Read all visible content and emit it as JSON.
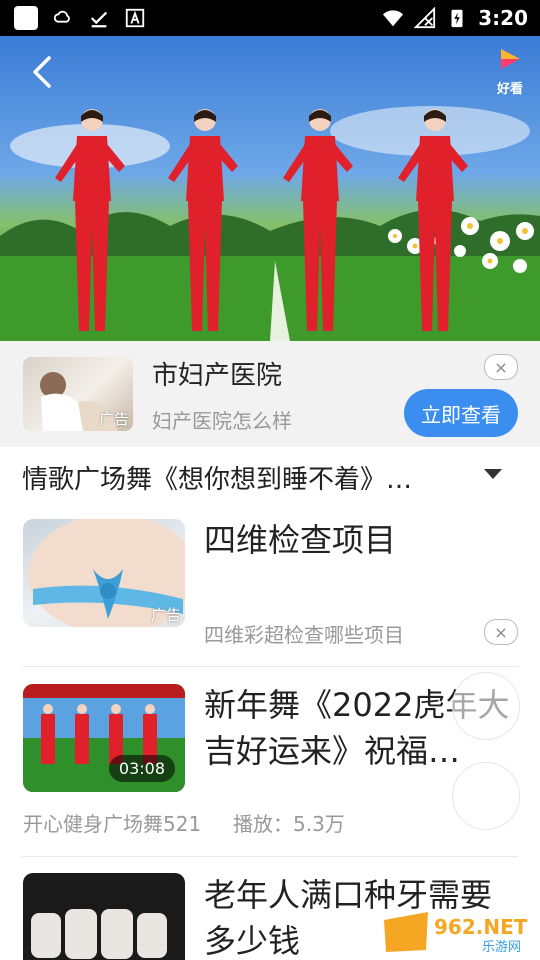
{
  "status_bar": {
    "time": "3:20"
  },
  "player": {
    "brand_label": "好看"
  },
  "ad_banner": {
    "tag": "广告",
    "title": "市妇产医院",
    "subtitle": "妇产医院怎么样",
    "cta": "立即查看",
    "close_glyph": "×"
  },
  "video_title": "情歌广场舞《想你想到睡不着》…",
  "feed": [
    {
      "type": "ad",
      "title": "四维检查项目",
      "subtitle": "四维彩超检查哪些项目",
      "tag": "广告",
      "close_glyph": "×"
    },
    {
      "type": "video",
      "title": "新年舞《2022虎年大吉好运来》祝福…",
      "duration": "03:08",
      "author": "开心健身广场舞521",
      "plays": "播放：5.3万"
    },
    {
      "type": "video",
      "title": "老年人满口种牙需要多少钱"
    }
  ],
  "watermark": {
    "text": "962.NET",
    "sub": "乐游网"
  },
  "colors": {
    "accent": "#3b8ef0",
    "dancer_red": "#e0202a"
  }
}
